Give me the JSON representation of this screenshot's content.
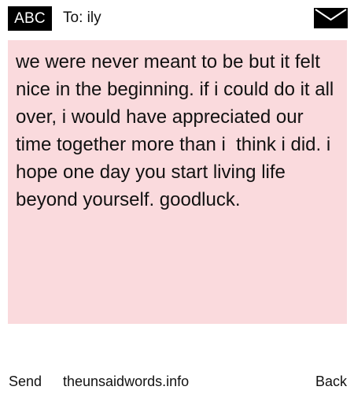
{
  "header": {
    "mode_label": "ABC",
    "recipient_label": "To: ily",
    "icon": "envelope-icon"
  },
  "message": {
    "body": "we were never meant to be but it felt nice in the beginning. if i could do it all over, i would have appreciated our time together more than i  think i did. i hope one day you start living life beyond yourself. goodluck."
  },
  "footer": {
    "send_label": "Send",
    "site_label": "theunsaidwords.info",
    "back_label": "Back"
  },
  "colors": {
    "message_background": "#fadadd",
    "badge_background": "#000000",
    "badge_text": "#ffffff",
    "text": "#111111"
  }
}
